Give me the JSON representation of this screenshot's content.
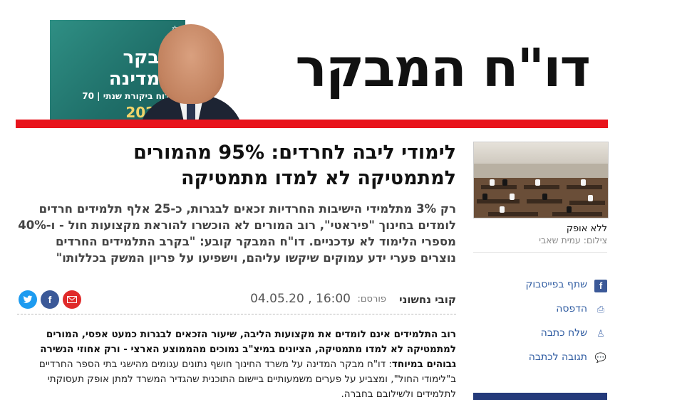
{
  "banner": {
    "masthead": "דו\"ח המבקר",
    "book": {
      "line1": "מבקר",
      "line2": "המדינה",
      "subtitle": "דוח ביקורת שנתי | 70",
      "year": "2020",
      "emblem": "✡"
    },
    "colors": {
      "accent_red": "#e8141c",
      "book_teal": "#2f8f84"
    }
  },
  "article": {
    "headline": "לימודי ליבה לחרדים: 95% מהמורים למתמטיקה לא למדו מתמטיקה",
    "subhead": "רק 3% מתלמידי הישיבות החרדיות זכאים לבגרות, כ-25 אלף תלמידים חרדים לומדים בחינוך \"פיראטי\", רוב המורים לא הוכשרו להוראת מקצועות חול - ו-40% מספרי הלימוד לא עדכניים. דו\"ח המבקר קובע: \"בקרב התלמידים החרדים נוצרים פערי ידע עמוקים שיקשו עליהם, וישפיעו על פריון המשק בכללותו\"",
    "author": "קובי נחשוני",
    "published_label": "פורסם:",
    "published_time": "04.05.20 , 16:00",
    "body_bold": "רוב התלמידים אינם לומדים את מקצועות הליבה, שיעור הזכאים לבגרות כמעט אפסי, המורים למתמטיקה לא למדו מתמטיקה, הציונים במיצ\"ב נמוכים מהממוצע הארצי - ורק אחוזי הנשירה גבוהים במיוחד",
    "body_rest": ": דו\"ח מבקר המדינה על משרד החינוך חושף נתונים עגומים מהישגי בתי הספר החרדיים ב\"לימודי החול\", ומצביע על פערים משמעותיים ביישום התוכנית שהגדיר המשרד למתן אופק תעסוקתי לתלמידים ולשילובם בחברה."
  },
  "social": {
    "twitter_icon": "twitter-icon",
    "facebook_icon": "facebook-icon",
    "mail_icon": "mail-icon"
  },
  "sidebar": {
    "photo_caption": "ללא אופק",
    "photo_credit": "צילום: עמית שאבי",
    "actions": [
      {
        "label": "שתף בפייסבוק",
        "icon": "facebook-icon"
      },
      {
        "label": "הדפסה",
        "icon": "print-icon"
      },
      {
        "label": "שלח כתבה",
        "icon": "user-icon"
      },
      {
        "label": "תגובה לכתבה",
        "icon": "comment-icon"
      }
    ],
    "colors": {
      "link": "#2d5aa0",
      "footer_bar": "#243a7a"
    }
  }
}
